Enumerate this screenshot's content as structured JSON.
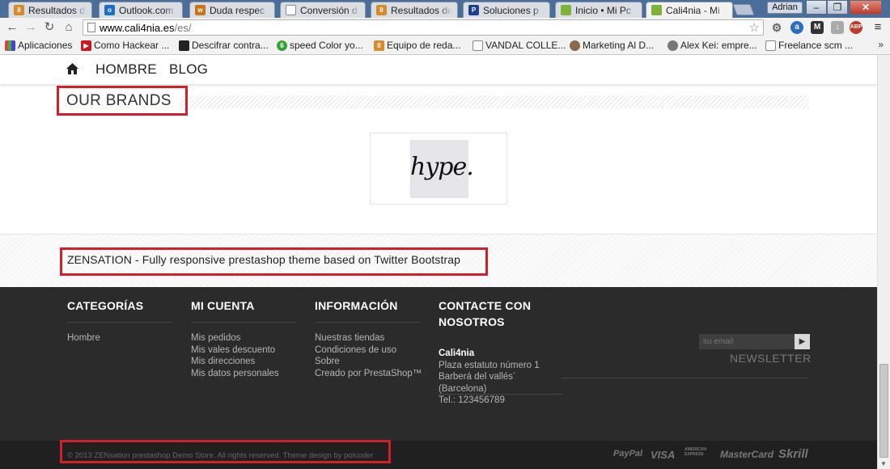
{
  "browser": {
    "tabs": [
      {
        "label": "Resultados de",
        "favicon": "8"
      },
      {
        "label": "Outlook.com",
        "favicon": "o"
      },
      {
        "label": "Duda respec",
        "favicon": "w"
      },
      {
        "label": "Conversión d",
        "favicon": ""
      },
      {
        "label": "Resultados de",
        "favicon": "8"
      },
      {
        "label": "Soluciones p",
        "favicon": "P"
      },
      {
        "label": "Inicio • Mi Pc",
        "favicon": ""
      },
      {
        "label": "Cali4nia - Mi",
        "favicon": ""
      }
    ],
    "user": "Adrian",
    "url_host": "www.cali4nia.es",
    "url_path": "/es/",
    "bookmarks": [
      "Aplicaciones",
      "Como Hackear ...",
      "Descifrar contra...",
      "speed Color yo...",
      "Equipo de reda...",
      "VANDAL COLLE...",
      "Marketing Al D...",
      "Alex Kei: empre...",
      "Freelance scm ..."
    ],
    "more_bookmarks": "»",
    "extensions": [
      "a",
      "M",
      "ABP"
    ]
  },
  "site": {
    "nav": [
      "HOMBRE",
      "BLOG"
    ],
    "brands_title": "OUR BRANDS",
    "brand_logo_text": "hype.",
    "zensation_text": "ZENSATION - Fully responsive prestashop theme based on Twitter Bootstrap",
    "footer": {
      "categorias": {
        "title": "CATEGORÍAS",
        "links": [
          "Hombre"
        ]
      },
      "mi_cuenta": {
        "title": "MI CUENTA",
        "links": [
          "Mis pedidos",
          "Mis vales descuento",
          "Mis direcciones",
          "Mis datos personales"
        ]
      },
      "informacion": {
        "title": "INFORMACIÓN",
        "links": [
          "Nuestras tiendas",
          "Condiciones de uso",
          "Sobre",
          "Creado por PrestaShop™"
        ]
      },
      "contacto": {
        "title_line1": "CONTACTE CON",
        "title_line2": "NOSOTROS",
        "name": "Cali4nia",
        "lines": [
          "Plaza estatuto número 1",
          "Barberá del vallés´",
          "(Barcelona)",
          "Tel.: 123456789"
        ]
      },
      "newsletter_placeholder": "su email",
      "newsletter_submit": "▶",
      "newsletter_label": "NEWSLETTER"
    },
    "copyright": "© 2013 ZENsation prestashop Demo Store. All rights reserved. Theme design by polcoder",
    "payments": [
      "PayPal",
      "VISA",
      "AMERICAN EXPRESS",
      "MasterCard",
      "Skrill"
    ]
  },
  "colors": {
    "highlight_box": "#d0202a",
    "footer_bg": "#2b2b2b",
    "bottom_bg": "#202020"
  }
}
